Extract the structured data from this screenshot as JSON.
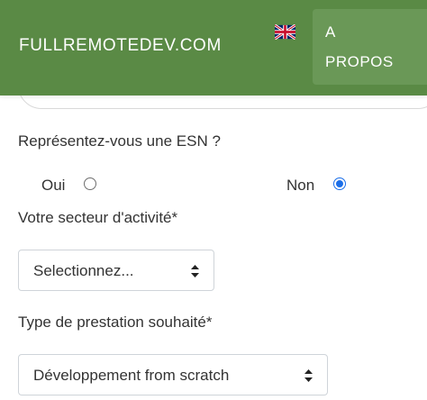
{
  "header": {
    "brand": "FULLREMOTEDEV.COM",
    "nav_about_line1": "A",
    "nav_about_line2": "PROPOS",
    "language_icon": "uk-flag-icon",
    "background_color": "#5a8a45"
  },
  "form": {
    "esn_question": "Représentez-vous une ESN ?",
    "esn_options": [
      {
        "label": "Oui",
        "selected": false
      },
      {
        "label": "Non",
        "selected": true
      }
    ],
    "sector_label": "Votre secteur d'activité*",
    "sector_value": "Selectionnez...",
    "service_label": "Type de prestation souhaité*",
    "service_value": "Développement from scratch"
  }
}
